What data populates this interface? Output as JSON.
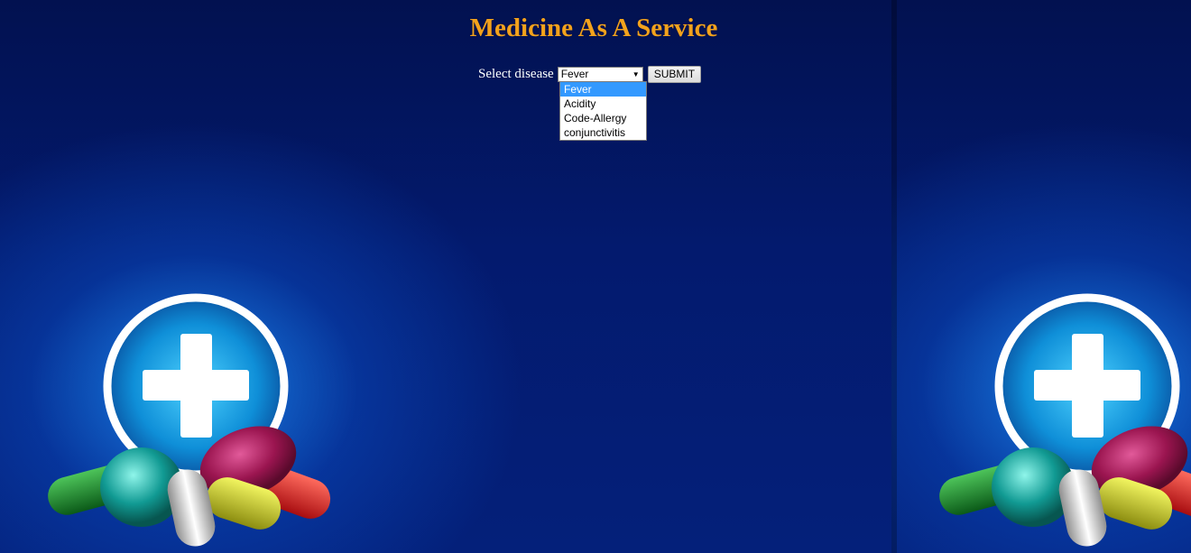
{
  "header": {
    "title": "Medicine As A Service"
  },
  "form": {
    "label": "Select disease",
    "selected_value": "Fever",
    "submit_label": "SUBMIT",
    "options": [
      "Fever",
      "Acidity",
      "Code-Allergy",
      "conjunctivitis"
    ]
  },
  "colors": {
    "title": "#f3a21c",
    "background": "#021464",
    "highlight": "#3399ff"
  },
  "icons": {
    "dropdown_arrow": "triangle-down",
    "background_art": "medical-cross-with-pills"
  }
}
